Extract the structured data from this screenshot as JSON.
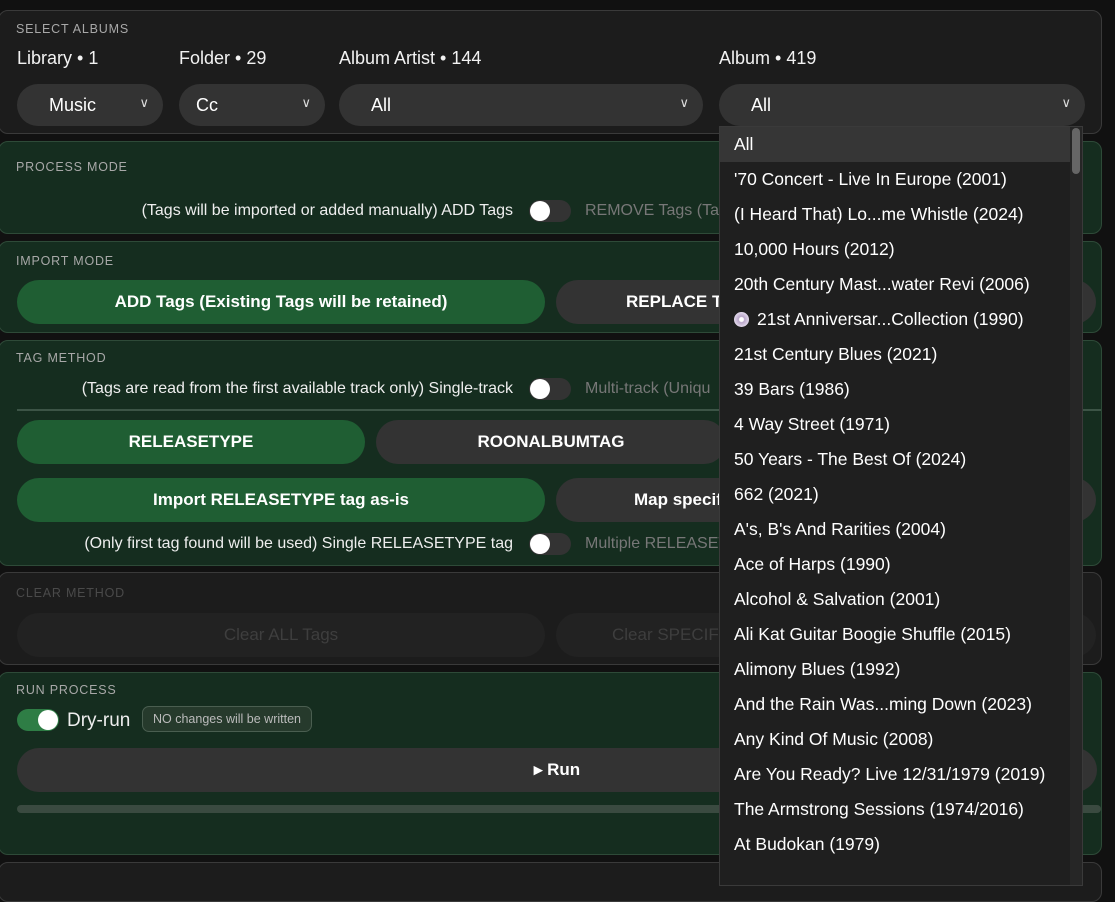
{
  "select_albums": {
    "title": "SELECT ALBUMS",
    "library": {
      "label": "Library • 1",
      "value": "Music"
    },
    "folder": {
      "label": "Folder • 29",
      "value": "Cc"
    },
    "album_artist": {
      "label": "Album Artist • 144",
      "value": "All"
    },
    "album": {
      "label": "Album • 419",
      "value": "All"
    }
  },
  "process_mode": {
    "title": "PROCESS MODE",
    "left": "(Tags will be imported or added manually) ADD Tags",
    "right": "REMOVE Tags (Ta"
  },
  "import_mode": {
    "title": "IMPORT MODE",
    "add": "ADD Tags  (Existing Tags will be retained)",
    "replace": "REPLACE Ta"
  },
  "tag_method": {
    "title": "TAG METHOD",
    "left": "(Tags are read from the first available track only) Single-track",
    "right": "Multi-track (Uniqu",
    "releasetype": "RELEASETYPE",
    "roonalbumtag": "ROONALBUMTAG",
    "import_asis": "Import RELEASETYPE tag as-is",
    "map_specific": "Map specif",
    "single_left": "(Only first tag found will be used) Single RELEASETYPE tag",
    "single_right": "Multiple RELEASET"
  },
  "clear_method": {
    "title": "CLEAR METHOD",
    "clear_all": "Clear ALL Tags",
    "clear_specific": "Clear SPECIFIC"
  },
  "run_process": {
    "title": "RUN PROCESS",
    "dry_run": "Dry-run",
    "dry_badge": "NO changes will be written",
    "run": "▸ Run"
  },
  "album_options": [
    "All",
    "'70 Concert - Live In Europe (2001)",
    "(I Heard That) Lo...me Whistle (2024)",
    "10,000 Hours (2012)",
    "20th Century Mast...water Revi (2006)",
    "21st Anniversar...Collection (1990)",
    "21st Century Blues (2021)",
    "39 Bars (1986)",
    "4 Way Street (1971)",
    "50 Years - The Best Of (2024)",
    "662 (2021)",
    "A's, B's And Rarities (2004)",
    "Ace of Harps (1990)",
    "Alcohol & Salvation (2001)",
    "Ali Kat Guitar Boogie Shuffle (2015)",
    "Alimony Blues  (1992)",
    "And the Rain Was...ming Down (2023)",
    "Any Kind Of Music (2008)",
    "Are You Ready? Live 12/31/1979 (2019)",
    "The Armstrong Sessions (1974/2016)",
    "At Budokan (1979)"
  ]
}
